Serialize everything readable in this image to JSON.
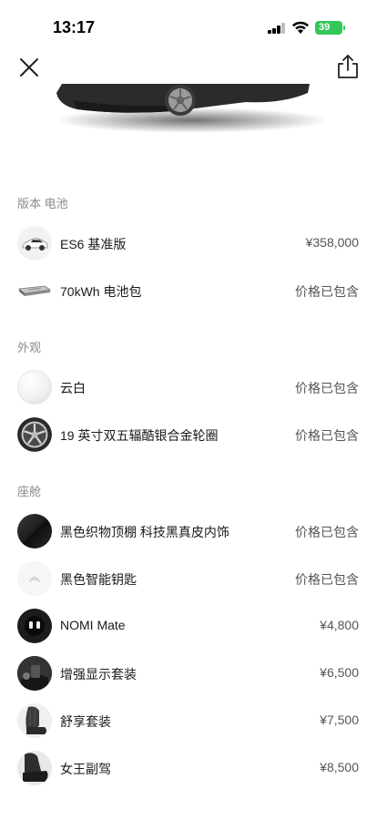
{
  "status_bar": {
    "time": "13:17",
    "battery": "39",
    "icons": [
      "signal-icon",
      "wifi-icon",
      "battery-icon"
    ],
    "battery_color": "#34c759"
  },
  "nav": {
    "close_icon": "close-icon",
    "share_icon": "share-icon"
  },
  "sections": [
    {
      "title": "版本 电池",
      "items": [
        {
          "name": "ES6 基准版",
          "price": "¥358,000",
          "icon": "car-icon"
        },
        {
          "name": "70kWh 电池包",
          "price": "价格已包含",
          "icon": "battery-pack-icon"
        }
      ]
    },
    {
      "title": "外观",
      "items": [
        {
          "name": "云白",
          "price": "价格已包含",
          "icon": "paint-swatch-icon"
        },
        {
          "name": "19 英寸双五辐酷银合金轮圈",
          "price": "价格已包含",
          "icon": "wheel-icon"
        }
      ]
    },
    {
      "title": "座舱",
      "items": [
        {
          "name": "黑色织物顶棚 科技黑真皮内饰",
          "price": "价格已包含",
          "icon": "interior-swatch-icon"
        },
        {
          "name": "黑色智能钥匙",
          "price": "价格已包含",
          "icon": "smart-key-icon"
        },
        {
          "name": "NOMI Mate",
          "price": "¥4,800",
          "icon": "nomi-icon"
        },
        {
          "name": "增强显示套装",
          "price": "¥6,500",
          "icon": "display-icon"
        },
        {
          "name": "舒享套装",
          "price": "¥7,500",
          "icon": "seat-icon"
        },
        {
          "name": "女王副驾",
          "price": "¥8,500",
          "icon": "passenger-seat-icon"
        }
      ]
    }
  ]
}
